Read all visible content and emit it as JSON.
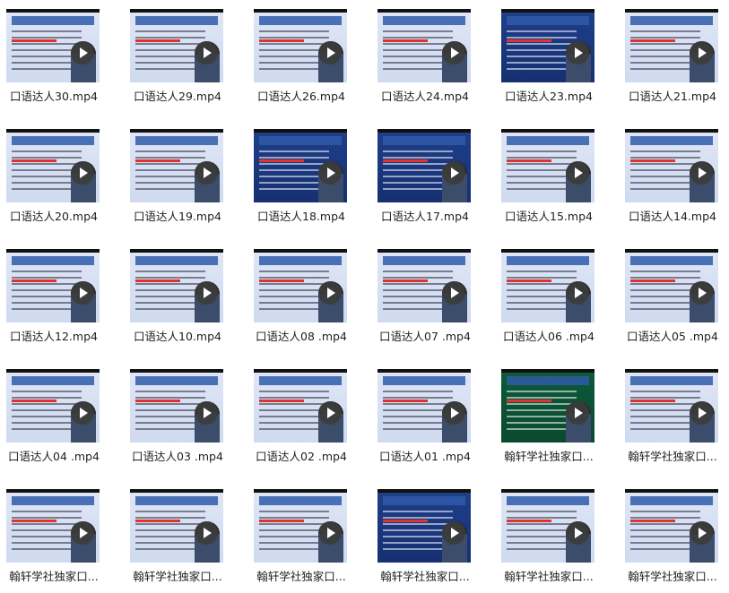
{
  "files": [
    {
      "name": "口语达人30.mp4",
      "style": "light"
    },
    {
      "name": "口语达人29.mp4",
      "style": "light"
    },
    {
      "name": "口语达人26.mp4",
      "style": "light"
    },
    {
      "name": "口语达人24.mp4",
      "style": "light"
    },
    {
      "name": "口语达人23.mp4",
      "style": "dark"
    },
    {
      "name": "口语达人21.mp4",
      "style": "light"
    },
    {
      "name": "口语达人20.mp4",
      "style": "light"
    },
    {
      "name": "口语达人19.mp4",
      "style": "light"
    },
    {
      "name": "口语达人18.mp4",
      "style": "dark"
    },
    {
      "name": "口语达人17.mp4",
      "style": "dark"
    },
    {
      "name": "口语达人15.mp4",
      "style": "light"
    },
    {
      "name": "口语达人14.mp4",
      "style": "light"
    },
    {
      "name": "口语达人12.mp4",
      "style": "light"
    },
    {
      "name": "口语达人10.mp4",
      "style": "light"
    },
    {
      "name": "口语达人08 .mp4",
      "style": "light"
    },
    {
      "name": "口语达人07 .mp4",
      "style": "light"
    },
    {
      "name": "口语达人06 .mp4",
      "style": "light"
    },
    {
      "name": "口语达人05 .mp4",
      "style": "light"
    },
    {
      "name": "口语达人04 .mp4",
      "style": "light"
    },
    {
      "name": "口语达人03 .mp4",
      "style": "light"
    },
    {
      "name": "口语达人02 .mp4",
      "style": "light"
    },
    {
      "name": "口语达人01 .mp4",
      "style": "light"
    },
    {
      "name": "翰轩学社独家口...",
      "style": "green"
    },
    {
      "name": "翰轩学社独家口...",
      "style": "light"
    },
    {
      "name": "翰轩学社独家口...",
      "style": "light"
    },
    {
      "name": "翰轩学社独家口...",
      "style": "light"
    },
    {
      "name": "翰轩学社独家口...",
      "style": "light"
    },
    {
      "name": "翰轩学社独家口...",
      "style": "dark"
    },
    {
      "name": "翰轩学社独家口...",
      "style": "light"
    },
    {
      "name": "翰轩学社独家口...",
      "style": "light"
    }
  ]
}
